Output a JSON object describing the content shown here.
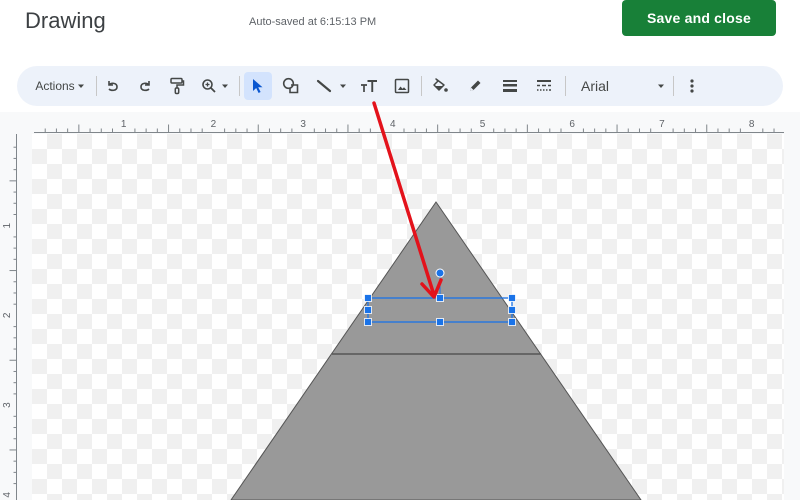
{
  "header": {
    "title": "Drawing",
    "autosave": "Auto-saved at 6:15:13 PM",
    "save_button": "Save and close"
  },
  "toolbar": {
    "actions_label": "Actions",
    "font": "Arial",
    "buttons": [
      {
        "icon": "undo-icon"
      },
      {
        "icon": "redo-icon"
      },
      {
        "icon": "paint-format-icon"
      },
      {
        "icon": "zoom-icon"
      },
      {
        "icon": "select-icon",
        "selected": true
      },
      {
        "icon": "shape-icon"
      },
      {
        "icon": "line-icon"
      },
      {
        "icon": "text-box-icon"
      },
      {
        "icon": "image-icon"
      },
      {
        "icon": "fill-color-icon"
      },
      {
        "icon": "border-color-icon"
      },
      {
        "icon": "border-weight-icon"
      },
      {
        "icon": "border-dash-icon"
      },
      {
        "icon": "more-options-icon"
      }
    ]
  },
  "rulers": {
    "horizontal_labels": [
      "1",
      "2",
      "3",
      "4",
      "5",
      "6",
      "7",
      "8"
    ],
    "vertical_labels": [
      "1",
      "2",
      "3",
      "4"
    ],
    "unit": "inch"
  },
  "drawing": {
    "shape_fill": "#999999",
    "shape_stroke": "#555555",
    "selection_color": "#1a73e8",
    "annotation_arrow_color": "#e3121b"
  }
}
